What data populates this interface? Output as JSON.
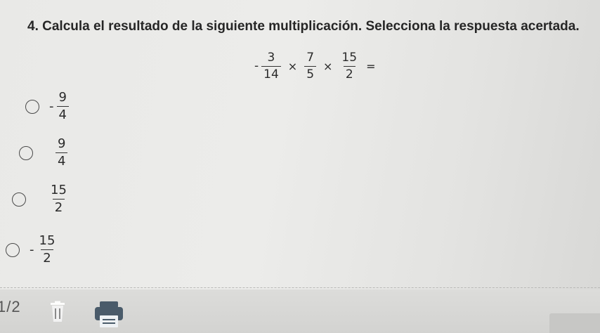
{
  "question": {
    "text": "4. Calcula el resultado de la siguiente multiplicación. Selecciona la respuesta acertada."
  },
  "expression": {
    "sign": "-",
    "fractions": [
      {
        "num": "3",
        "den": "14"
      },
      {
        "num": "7",
        "den": "5"
      },
      {
        "num": "15",
        "den": "2"
      }
    ],
    "times": "×",
    "equals": "="
  },
  "options": [
    {
      "sign": "-",
      "num": "9",
      "den": "4"
    },
    {
      "sign": "",
      "num": "9",
      "den": "4"
    },
    {
      "sign": "",
      "num": "15",
      "den": "2"
    },
    {
      "sign": "-",
      "num": "15",
      "den": "2"
    }
  ],
  "footer": {
    "page": "1/2",
    "icons": [
      "trash-icon",
      "printer-icon"
    ]
  }
}
